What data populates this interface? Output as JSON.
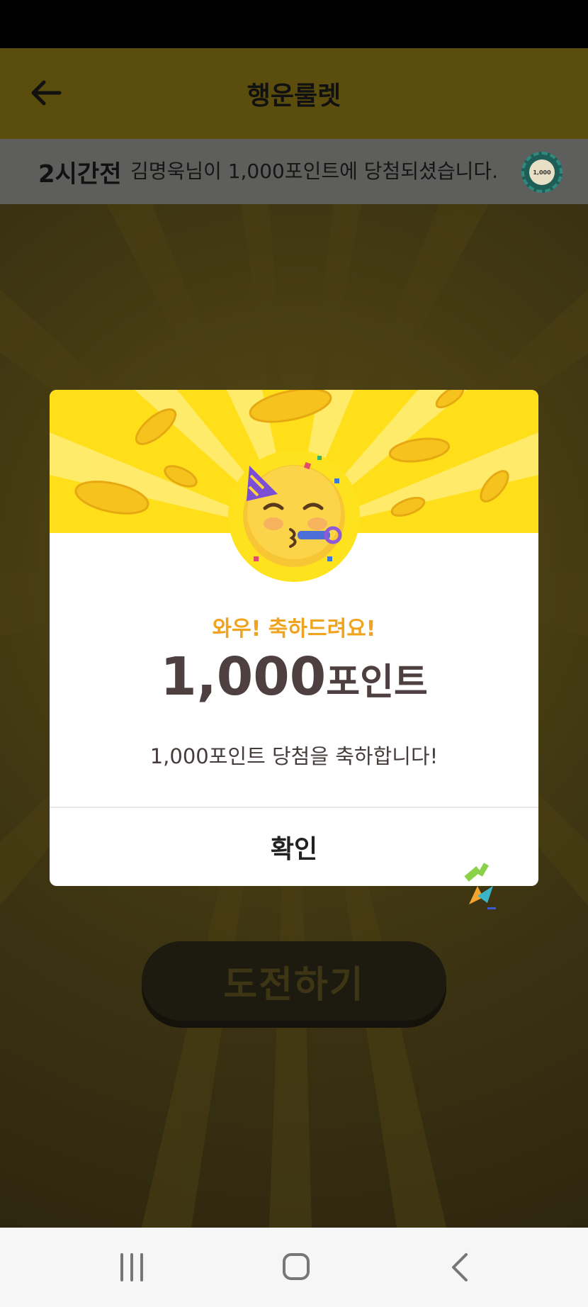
{
  "header": {
    "title": "행운룰렛",
    "back_icon": "arrow-left-icon"
  },
  "ticker": {
    "time": "2시간전",
    "message": "김명욱님이 1,000포인트에 당첨되셨습니다.",
    "chip_label": "1,000"
  },
  "modal": {
    "subtitle": "와우! 축하드려요!",
    "amount_number": "1,000",
    "amount_unit": "포인트",
    "description": "1,000포인트 당첨을 축하합니다!",
    "confirm_label": "확인",
    "emoji_icon": "partying-face-icon"
  },
  "main": {
    "challenge_label": "도전하기"
  },
  "nav": {
    "items": [
      "recent-apps-icon",
      "home-icon",
      "back-icon"
    ]
  },
  "colors": {
    "accent": "#ffde1a",
    "subtitle": "#f0a31c",
    "amount": "#4e4040"
  }
}
